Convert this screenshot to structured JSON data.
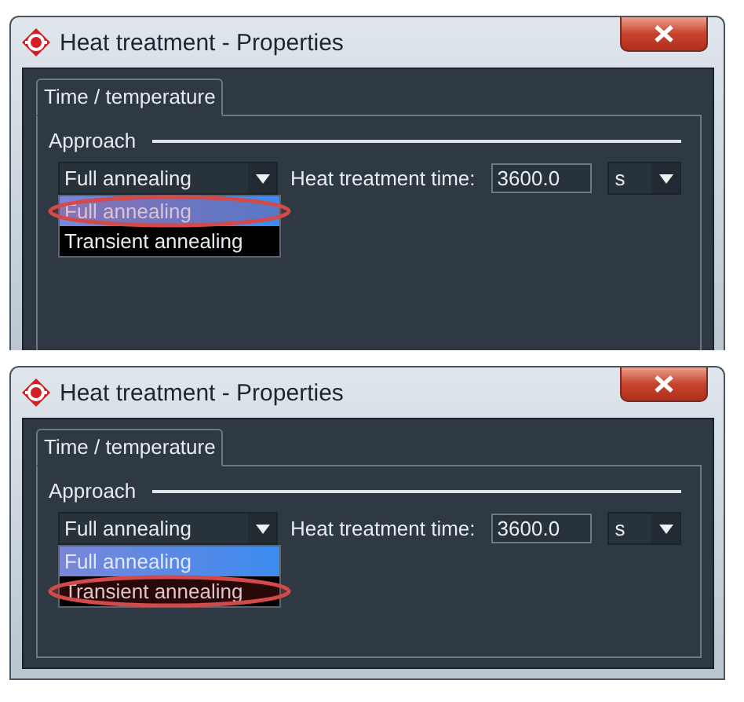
{
  "panels": [
    {
      "window": {
        "title": "Heat treatment - Properties"
      },
      "tabs": [
        {
          "label": "Time / temperature",
          "selected": true
        }
      ],
      "group": {
        "title": "Approach"
      },
      "approach": {
        "value": "Full annealing",
        "open": true,
        "options": [
          {
            "label": "Full annealing",
            "selected": true,
            "circled": true
          },
          {
            "label": "Transient annealing",
            "selected": false,
            "circled": false
          }
        ]
      },
      "time": {
        "label": "Heat treatment time:",
        "value": "3600.0",
        "unit": "s"
      }
    },
    {
      "window": {
        "title": "Heat treatment - Properties"
      },
      "tabs": [
        {
          "label": "Time / temperature",
          "selected": true
        }
      ],
      "group": {
        "title": "Approach"
      },
      "approach": {
        "value": "Full annealing",
        "open": true,
        "options": [
          {
            "label": "Full annealing",
            "selected": true,
            "circled": false
          },
          {
            "label": "Transient annealing",
            "selected": false,
            "circled": true
          }
        ]
      },
      "time": {
        "label": "Heat treatment time:",
        "value": "3600.0",
        "unit": "s"
      }
    }
  ]
}
